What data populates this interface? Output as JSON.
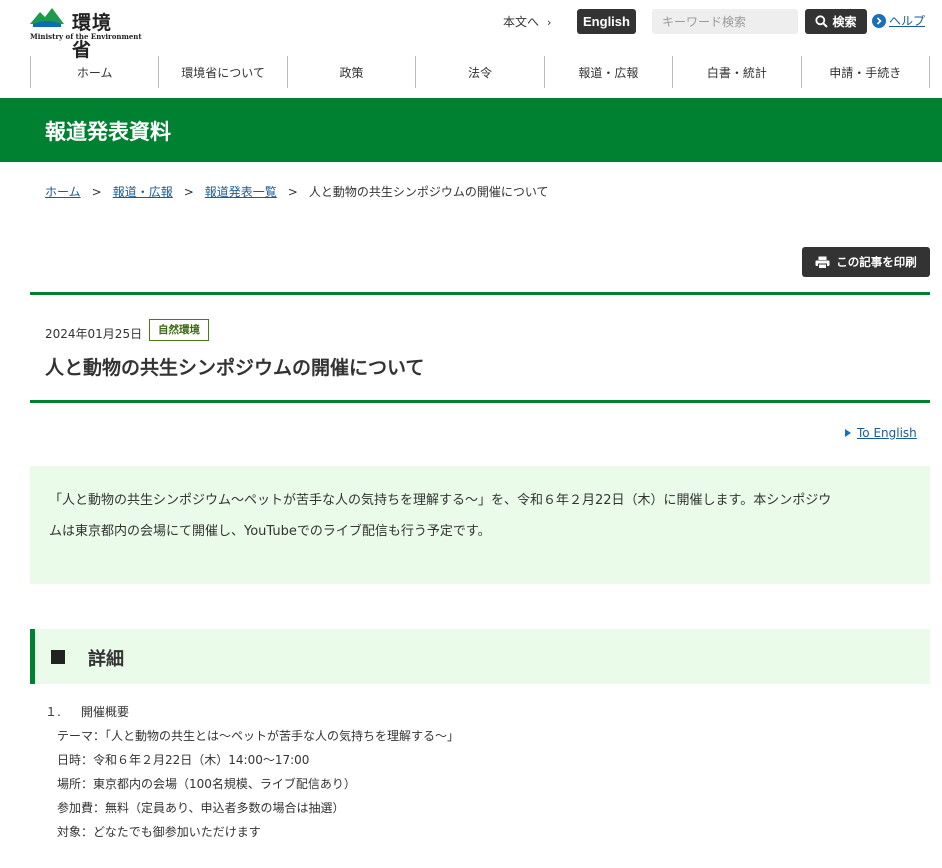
{
  "header": {
    "logo_ja": "環境省",
    "logo_en": "Ministry of the Environment",
    "skip_link": "本文へ",
    "english_button": "English",
    "search_placeholder": "キーワード検索",
    "search_button": "検索",
    "help_link": "ヘルプ"
  },
  "nav": {
    "items": [
      "ホーム",
      "環境省について",
      "政策",
      "法令",
      "報道・広報",
      "白書・統計",
      "申請・手続き"
    ]
  },
  "banner": {
    "title": "報道発表資料"
  },
  "breadcrumb": {
    "home": "ホーム",
    "press": "報道・広報",
    "list": "報道発表一覧",
    "current": "人と動物の共生シンポジウムの開催について",
    "separator": ">"
  },
  "print_button": "この記事を印刷",
  "article": {
    "date": "2024年01月25日",
    "category": "自然環境",
    "title": "人と動物の共生シンポジウムの開催について",
    "to_english": "To English",
    "summary_line1": "「人と動物の共生シンポジウム～ペットが苦手な人の気持ちを理解する～」を、令和６年２月22日（木）に開催します。本シンポジウ",
    "summary_line2": "ムは東京都内の会場にて開催し、YouTubeでのライブ配信も行う予定です。",
    "section_heading": "詳細",
    "details": {
      "num": "１.",
      "heading": "開催概要",
      "theme": "テーマ：「人と動物の共生とは～ペットが苦手な人の気持ちを理解する～」",
      "datetime": "日時：令和６年２月22日（木）14:00～17:00",
      "place": "場所：東京都内の会場（100名規模、ライブ配信あり）",
      "fee": "参加費：無料（定員あり、申込者多数の場合は抽選）",
      "target": "対象：どなたでも御参加いただけます"
    }
  },
  "colors": {
    "brand_green": "#008132",
    "light_green": "#eafbe9",
    "link_blue": "#1a5a96",
    "dark_button": "#333333"
  },
  "icons": {
    "logo": "mountain-logo-icon",
    "skip": "chevron-right-icon",
    "search": "search-icon",
    "help": "help-circle-icon",
    "print": "printer-icon",
    "to_english": "triangle-right-icon",
    "section": "square-bullet-icon"
  }
}
